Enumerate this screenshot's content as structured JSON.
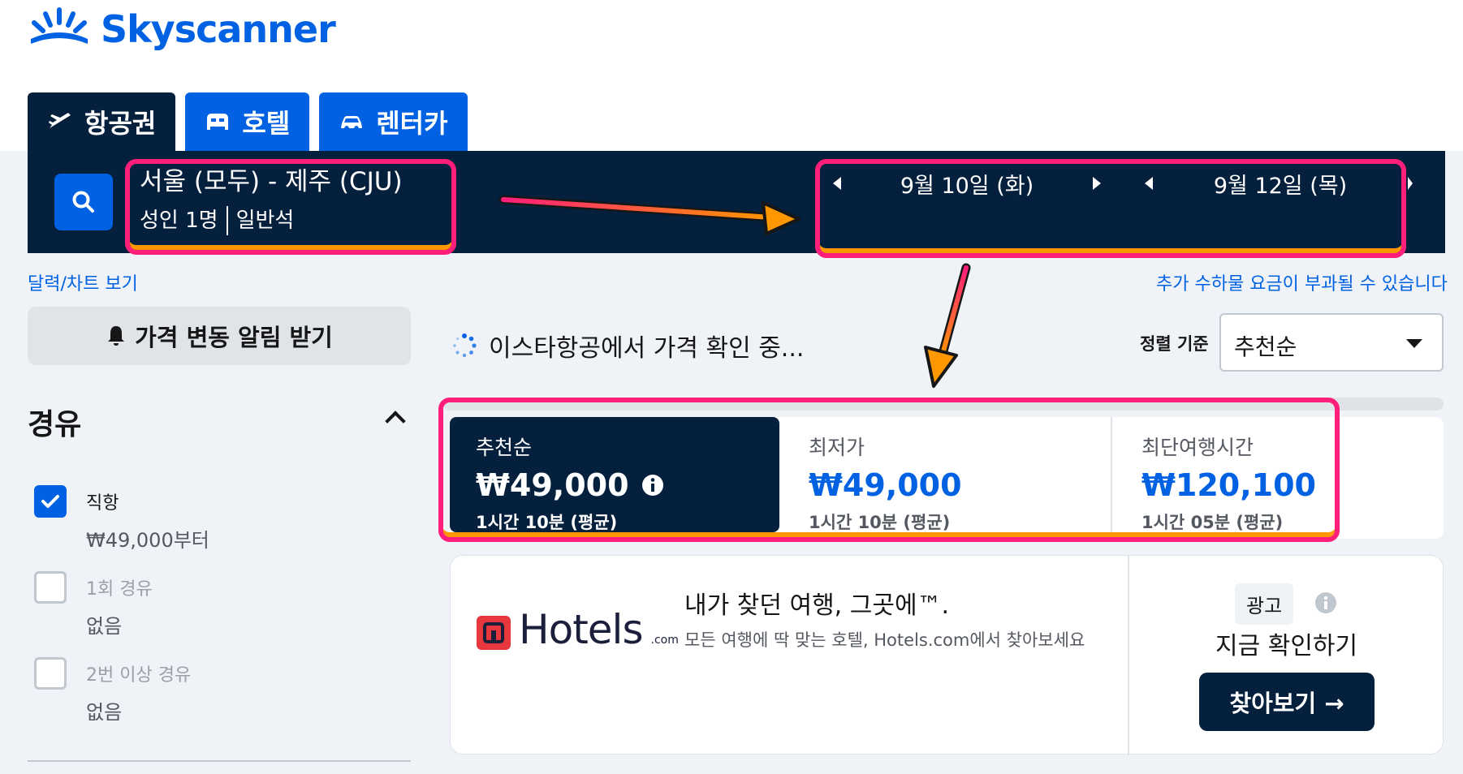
{
  "brand": {
    "name": "Skyscanner",
    "color": "#0062e3"
  },
  "tabs": [
    {
      "label": "항공권",
      "icon": "plane-icon",
      "active": true
    },
    {
      "label": "호텔",
      "icon": "bed-icon",
      "active": false
    },
    {
      "label": "렌터카",
      "icon": "car-icon",
      "active": false
    }
  ],
  "search": {
    "route": "서울 (모두) - 제주 (CJU)",
    "passengers": "성인 1명",
    "cabin": "일반석",
    "depart_date": "9월 10일 (화)",
    "return_date": "9월 12일 (목)"
  },
  "links": {
    "calendar": "달력/차트 보기",
    "baggage_notice": "추가 수하물 요금이 부과될 수 있습니다"
  },
  "alert_button": "가격 변동 알림 받기",
  "filters": {
    "title": "경유",
    "options": [
      {
        "label": "직항",
        "sub": "₩49,000부터",
        "checked": true,
        "disabled": false
      },
      {
        "label": "1회 경유",
        "sub": "없음",
        "checked": false,
        "disabled": true
      },
      {
        "label": "2번 이상 경유",
        "sub": "없음",
        "checked": false,
        "disabled": true
      }
    ]
  },
  "loading_text": "이스타항공에서 가격 확인 중...",
  "sort": {
    "label": "정렬 기준",
    "value": "추천순"
  },
  "price_tabs": [
    {
      "title": "추천순",
      "price": "₩49,000",
      "duration": "1시간 10분 (평균)",
      "selected": true
    },
    {
      "title": "최저가",
      "price": "₩49,000",
      "duration": "1시간 10분 (평균)",
      "selected": false
    },
    {
      "title": "최단여행시간",
      "price": "₩120,100",
      "duration": "1시간 05분 (평균)",
      "selected": false
    }
  ],
  "ad": {
    "brand": "Hotels",
    "brand_suffix": ".com",
    "headline": "내가 찾던 여행, 그곳에™.",
    "subline": "모든 여행에 딱 맞는 호텔, Hotels.com에서 찾아보세요",
    "badge": "광고",
    "cta_text": "지금 확인하기",
    "button": "찾아보기 →"
  },
  "colors": {
    "navy": "#05203c",
    "blue": "#0062e3",
    "highlight_pink": "#ff1e7a",
    "highlight_orange": "#ff9800"
  }
}
